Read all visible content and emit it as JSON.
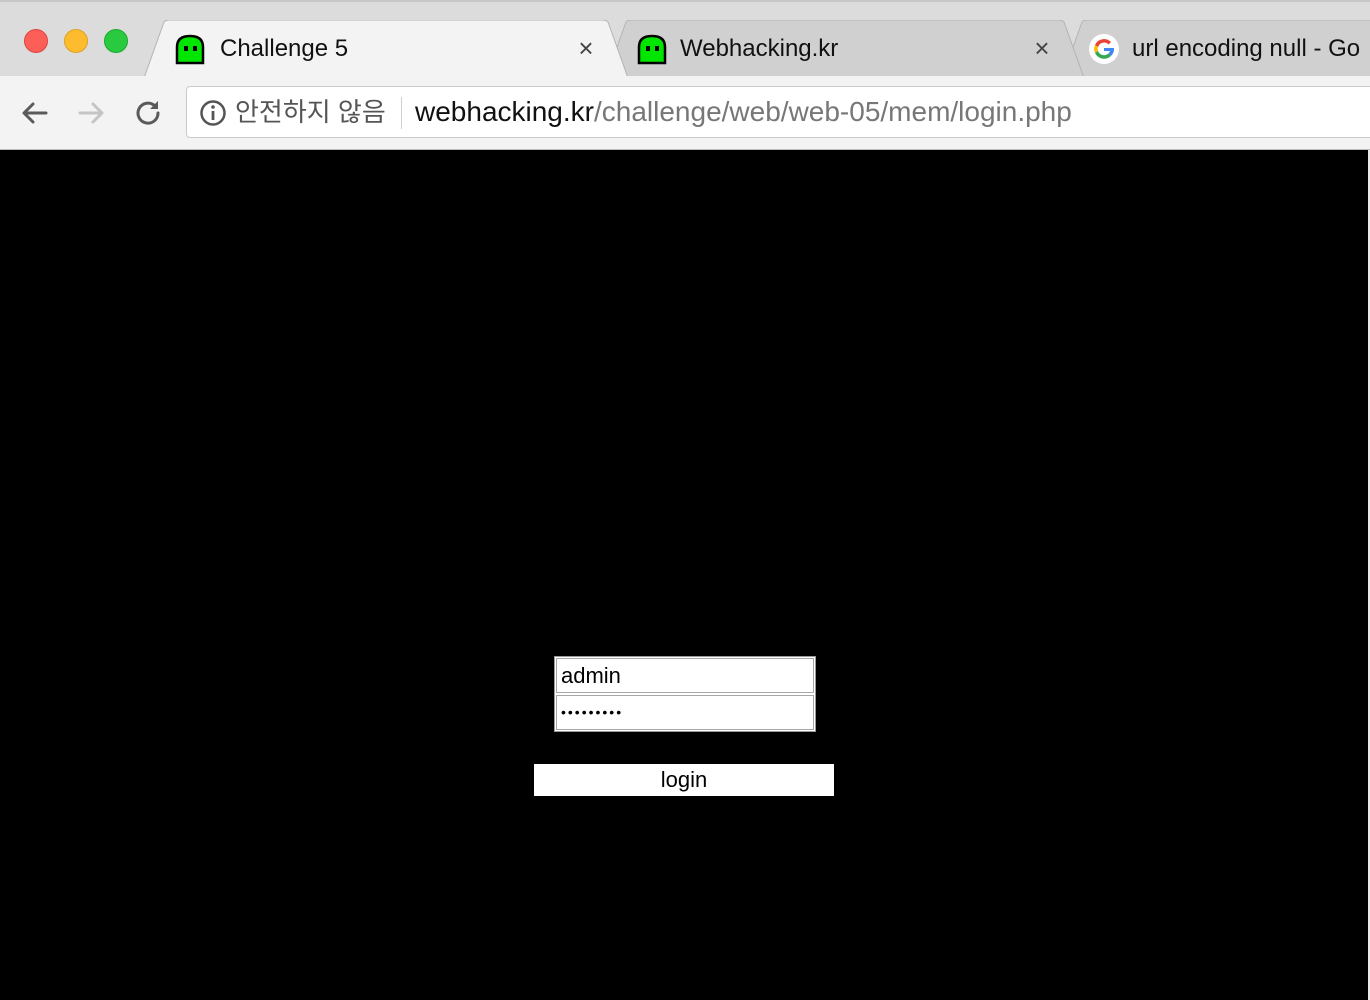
{
  "browser": {
    "tabs": [
      {
        "title": "Challenge 5",
        "favicon": "green-ghost-icon",
        "active": true
      },
      {
        "title": "Webhacking.kr",
        "favicon": "green-ghost-icon",
        "active": false
      },
      {
        "title": "url encoding null - Go",
        "favicon": "google-icon",
        "active": false
      }
    ],
    "close_glyph": "×",
    "toolbar": {
      "back_icon": "back-arrow-icon",
      "forward_icon": "forward-arrow-icon",
      "reload_icon": "reload-icon"
    },
    "address_bar": {
      "security_label": "안전하지 않음",
      "url_host": "webhacking.kr",
      "url_path": "/challenge/web/web-05/mem/login.php"
    }
  },
  "page": {
    "background_color": "#000000",
    "login_form": {
      "id_value": "admin",
      "password_mask": "•••••••••",
      "submit_label": "login"
    }
  },
  "colors": {
    "traffic_close": "#fc5f57",
    "traffic_minimize": "#fdbc2e",
    "traffic_maximize": "#29c940",
    "ghost_green": "#00e600"
  }
}
